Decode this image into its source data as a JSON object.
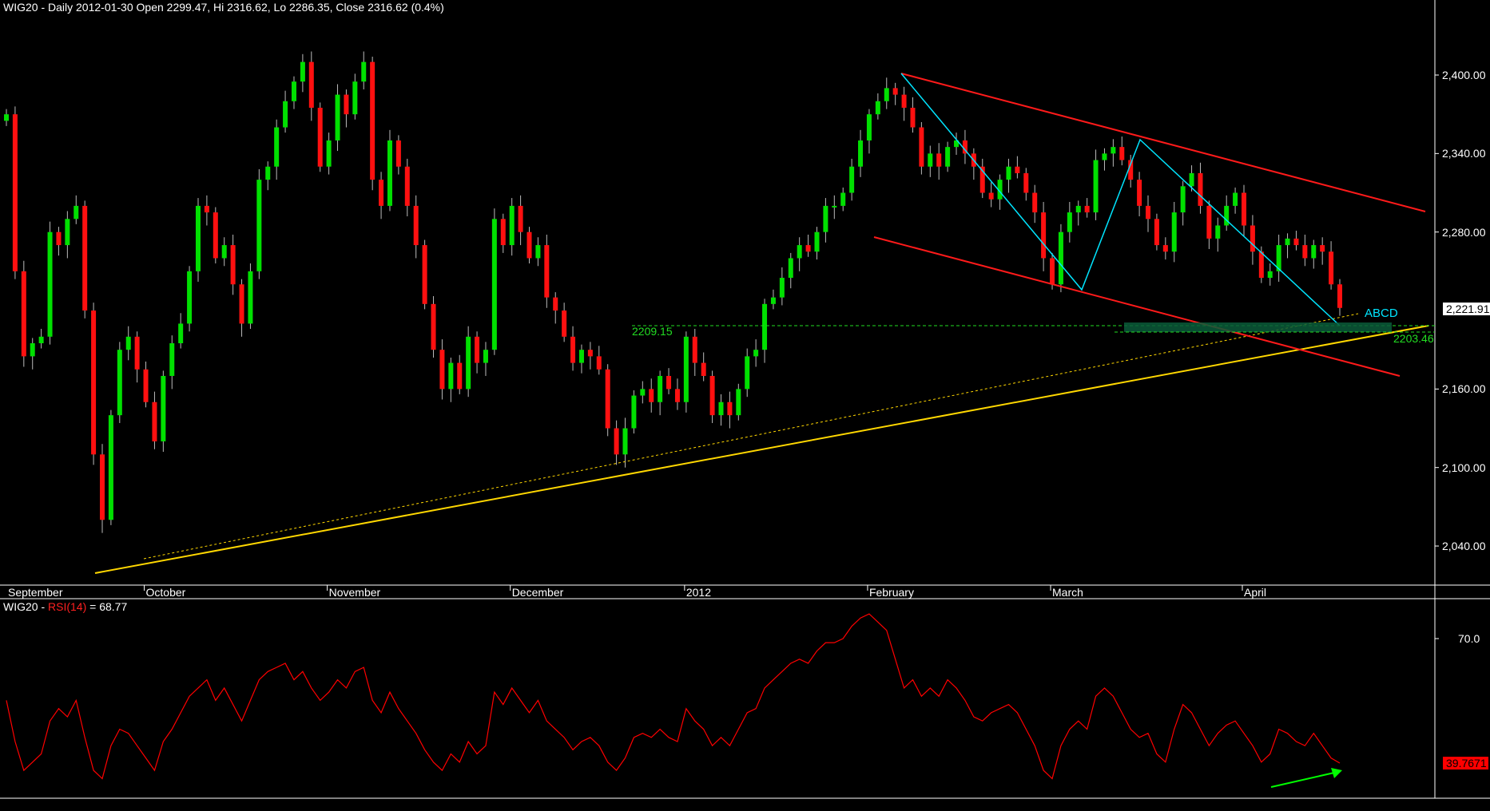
{
  "header": {
    "title": "WIG20 - Daily 2012-01-30 Open 2299.47, Hi 2316.62, Lo 2286.35, Close 2316.62 (0.4%)"
  },
  "rsi_header": {
    "prefix": "WIG20 - ",
    "indicator": "RSI(14)",
    "value": "= 68.77"
  },
  "annotations": {
    "support_level": "2209.15",
    "pattern_label": "ABCD",
    "target_level": "2203.46",
    "last_price_tag": "2,221.91",
    "rsi_last_tag": "39.7671"
  },
  "colors": {
    "up": "#00e000",
    "down": "#ff1010",
    "trend": "#ffd700",
    "channel": "#ff1a1a",
    "pattern": "#00e5ff",
    "level": "#22dd22",
    "rsi": "#ff0000"
  },
  "chart_data": [
    {
      "type": "candlestick",
      "title": "WIG20 - Daily",
      "price_ticks": [
        "2,400.00",
        "2,340.00",
        "2,280.00",
        "2,160.00",
        "2,100.00",
        "2,040.00"
      ],
      "price_tick_values": [
        2400,
        2340,
        2280,
        2160,
        2100,
        2040
      ],
      "ylim": [
        2010,
        2430
      ],
      "months": [
        "September",
        "October",
        "November",
        "December",
        "2012",
        "February",
        "March",
        "April"
      ],
      "month_start_index": [
        0,
        16,
        37,
        58,
        78,
        99,
        120,
        142
      ],
      "first_open": 2365,
      "close": [
        2370,
        2250,
        2185,
        2195,
        2200,
        2280,
        2270,
        2290,
        2300,
        2220,
        2110,
        2060,
        2140,
        2190,
        2200,
        2175,
        2150,
        2120,
        2170,
        2195,
        2210,
        2250,
        2300,
        2295,
        2260,
        2270,
        2240,
        2210,
        2250,
        2320,
        2330,
        2360,
        2380,
        2395,
        2410,
        2375,
        2330,
        2350,
        2385,
        2370,
        2395,
        2410,
        2320,
        2300,
        2350,
        2330,
        2300,
        2270,
        2225,
        2190,
        2160,
        2180,
        2160,
        2200,
        2180,
        2190,
        2290,
        2270,
        2300,
        2280,
        2260,
        2270,
        2230,
        2220,
        2200,
        2180,
        2190,
        2185,
        2175,
        2130,
        2110,
        2130,
        2155,
        2160,
        2150,
        2170,
        2160,
        2150,
        2200,
        2180,
        2170,
        2140,
        2150,
        2140,
        2160,
        2185,
        2190,
        2225,
        2230,
        2245,
        2260,
        2270,
        2265,
        2280,
        2300,
        2300,
        2310,
        2330,
        2350,
        2370,
        2380,
        2390,
        2385,
        2375,
        2360,
        2330,
        2340,
        2330,
        2345,
        2350,
        2340,
        2330,
        2310,
        2305,
        2320,
        2330,
        2325,
        2310,
        2295,
        2260,
        2240,
        2280,
        2295,
        2300,
        2295,
        2335,
        2340,
        2345,
        2335,
        2320,
        2300,
        2290,
        2270,
        2265,
        2295,
        2315,
        2325,
        2300,
        2275,
        2285,
        2300,
        2310,
        2285,
        2265,
        2245,
        2250,
        2270,
        2275,
        2270,
        2260,
        2270,
        2265,
        2240,
        2222
      ],
      "last_close": 2221.91,
      "support_level": 2209.15,
      "target_level": 2203.46
    },
    {
      "type": "line",
      "title": "RSI(14)",
      "ticks": [
        "70.0"
      ],
      "tick_values": [
        70
      ],
      "ylim": [
        30,
        80
      ],
      "values": [
        55,
        45,
        38,
        40,
        42,
        50,
        53,
        51,
        55,
        46,
        38,
        36,
        44,
        48,
        47,
        44,
        41,
        38,
        45,
        48,
        52,
        56,
        58,
        60,
        55,
        58,
        54,
        50,
        55,
        60,
        62,
        63,
        64,
        60,
        62,
        58,
        55,
        57,
        60,
        58,
        62,
        63,
        55,
        52,
        57,
        53,
        50,
        47,
        43,
        40,
        38,
        42,
        40,
        45,
        42,
        44,
        57,
        54,
        58,
        55,
        52,
        55,
        50,
        48,
        46,
        43,
        45,
        46,
        44,
        40,
        38,
        41,
        46,
        47,
        46,
        48,
        46,
        45,
        53,
        50,
        48,
        44,
        46,
        44,
        48,
        52,
        53,
        58,
        60,
        62,
        64,
        65,
        64,
        67,
        69,
        69,
        70,
        73,
        75,
        76,
        74,
        72,
        65,
        58,
        60,
        56,
        58,
        56,
        60,
        58,
        55,
        51,
        50,
        52,
        53,
        54,
        52,
        48,
        44,
        38,
        36,
        44,
        48,
        50,
        48,
        56,
        58,
        56,
        52,
        48,
        46,
        47,
        42,
        40,
        48,
        54,
        52,
        48,
        44,
        47,
        49,
        50,
        47,
        44,
        40,
        42,
        48,
        47,
        45,
        44,
        47,
        44,
        41,
        39.77
      ]
    }
  ]
}
